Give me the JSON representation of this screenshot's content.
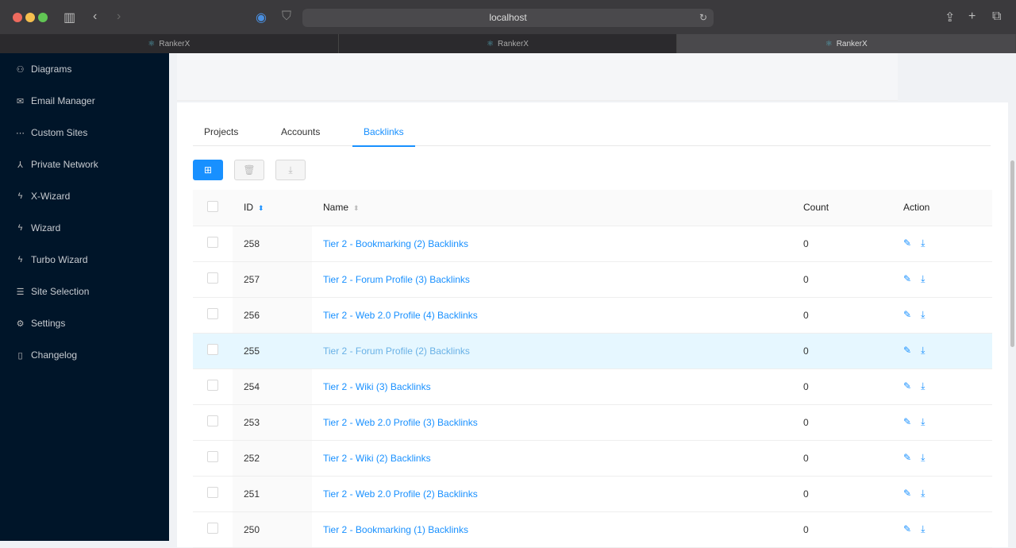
{
  "browser": {
    "url": "localhost",
    "tabs": [
      {
        "label": "RankerX",
        "active": false
      },
      {
        "label": "RankerX",
        "active": false
      },
      {
        "label": "RankerX",
        "active": true
      }
    ]
  },
  "sidebar": {
    "items": [
      {
        "label": "Diagrams",
        "icon": "diagram-icon"
      },
      {
        "label": "Email Manager",
        "icon": "mail-icon"
      },
      {
        "label": "Custom Sites",
        "icon": "ellipsis-icon"
      },
      {
        "label": "Private Network",
        "icon": "network-icon"
      },
      {
        "label": "X-Wizard",
        "icon": "bolt-icon"
      },
      {
        "label": "Wizard",
        "icon": "bolt-icon"
      },
      {
        "label": "Turbo Wizard",
        "icon": "bolt-icon"
      },
      {
        "label": "Site Selection",
        "icon": "list-icon"
      },
      {
        "label": "Settings",
        "icon": "gear-icon"
      },
      {
        "label": "Changelog",
        "icon": "file-icon"
      }
    ]
  },
  "page_tabs": [
    "Projects",
    "Accounts",
    "Backlinks"
  ],
  "active_tab": "Backlinks",
  "table": {
    "headers": {
      "id": "ID",
      "name": "Name",
      "count": "Count",
      "action": "Action"
    },
    "rows": [
      {
        "id": "258",
        "name": "Tier 2 - Bookmarking (2) Backlinks",
        "count": "0"
      },
      {
        "id": "257",
        "name": "Tier 2 - Forum Profile (3) Backlinks",
        "count": "0"
      },
      {
        "id": "256",
        "name": "Tier 2 - Web 2.0 Profile (4) Backlinks",
        "count": "0"
      },
      {
        "id": "255",
        "name": "Tier 2 - Forum Profile (2) Backlinks",
        "count": "0"
      },
      {
        "id": "254",
        "name": "Tier 2 - Wiki (3) Backlinks",
        "count": "0"
      },
      {
        "id": "253",
        "name": "Tier 2 - Web 2.0 Profile (3) Backlinks",
        "count": "0"
      },
      {
        "id": "252",
        "name": "Tier 2 - Wiki (2) Backlinks",
        "count": "0"
      },
      {
        "id": "251",
        "name": "Tier 2 - Web 2.0 Profile (2) Backlinks",
        "count": "0"
      },
      {
        "id": "250",
        "name": "Tier 2 - Bookmarking (1) Backlinks",
        "count": "0"
      }
    ],
    "hovered_row": "255"
  },
  "colors": {
    "accent": "#1890ff",
    "sidebar": "#001529"
  }
}
